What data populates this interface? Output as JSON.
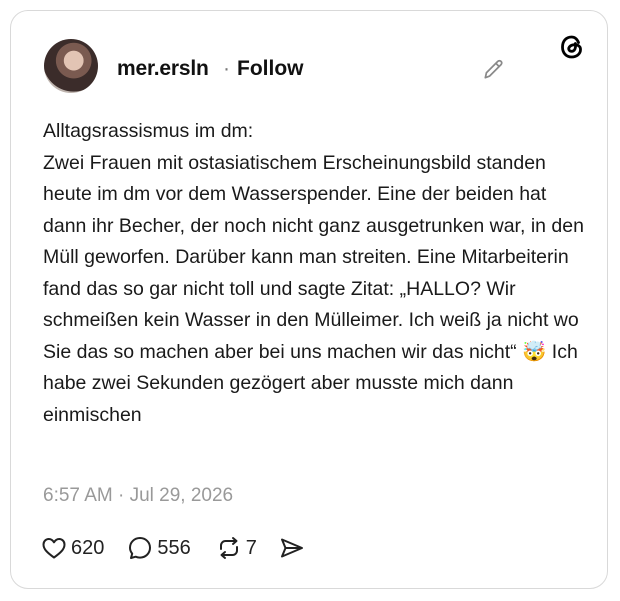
{
  "post": {
    "username": "mer.ersln",
    "separator": "·",
    "follow_label": "Follow",
    "text": "Alltagsrassismus im dm:\nZwei Frauen mit ostasiatischem Erscheinungsbild standen heute im dm vor dem Wasserspender. Eine der beiden hat dann ihr Becher, der noch nicht ganz ausgetrunken war, in den Müll geworfen. Darüber kann man streiten. Eine Mitarbeiterin fand das so gar nicht toll und sagte Zitat: „HALLO? Wir schmeißen kein Wasser in den Mülleimer. Ich weiß ja nicht wo Sie das so machen aber bei uns machen wir das nicht“ 🤯 Ich habe zwei Sekunden gezögert aber musste mich dann einmischen",
    "timestamp": "6:57 AM · Jul 29, 2026"
  },
  "actions": {
    "likes": "620",
    "comments": "556",
    "reposts": "7"
  },
  "icons": {
    "logo": "threads-logo-icon",
    "edit": "pencil-icon",
    "like": "heart-icon",
    "comment": "comment-bubble-icon",
    "repost": "repost-icon",
    "share": "send-icon"
  }
}
